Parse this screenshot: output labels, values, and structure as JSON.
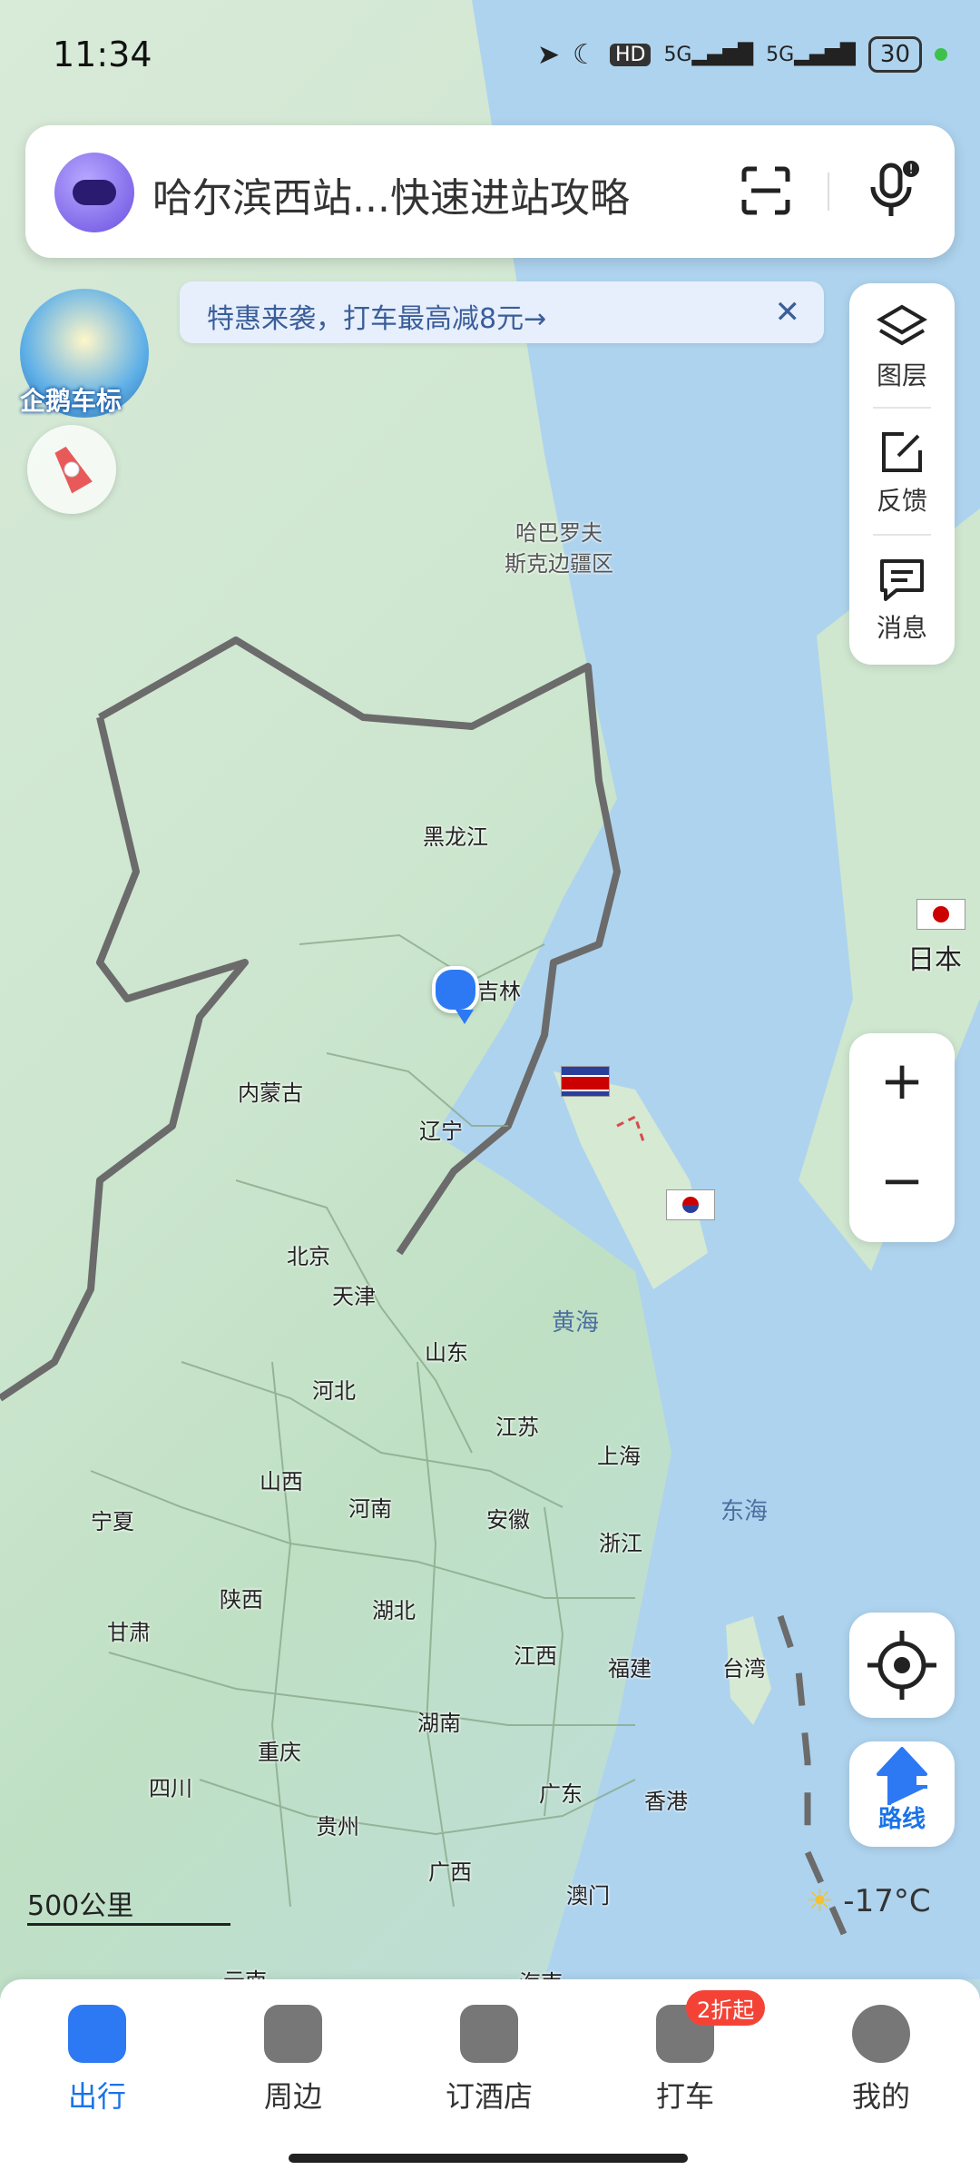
{
  "status_bar": {
    "time": "11:34",
    "signal_label": "5G",
    "battery": "30"
  },
  "search": {
    "query": "哈尔滨西站...快速进站攻略"
  },
  "promo": {
    "text": "特惠来袭，打车最高减8元→",
    "close": "✕"
  },
  "left_controls": {
    "penguin_label": "企鹅车标"
  },
  "right_panel": {
    "items": [
      {
        "label": "图层",
        "icon": "layers-icon"
      },
      {
        "label": "反馈",
        "icon": "feedback-icon"
      },
      {
        "label": "消息",
        "icon": "message-icon"
      }
    ]
  },
  "zoom": {
    "plus": "+",
    "minus": "−"
  },
  "route": {
    "label": "路线"
  },
  "weather": {
    "text": "-17°C"
  },
  "scale": {
    "text": "500公里"
  },
  "map_labels": {
    "khabarovsk": "哈巴罗夫\n斯克边疆区",
    "heilongjiang": "黑龙江",
    "jilin": "吉林",
    "neimenggu": "内蒙古",
    "liaoning": "辽宁",
    "beijing": "北京",
    "tianjin": "天津",
    "shandong": "山东",
    "hebei": "河北",
    "jiangsu": "江苏",
    "shanghai": "上海",
    "shanxi": "山西",
    "henan": "河南",
    "anhui": "安徽",
    "zhejiang": "浙江",
    "ningxia": "宁夏",
    "shaanxi": "陕西",
    "hubei": "湖北",
    "gansu": "甘肃",
    "jiangxi": "江西",
    "fujian": "福建",
    "taiwan": "台湾",
    "hunan": "湖南",
    "chongqing": "重庆",
    "sichuan": "四川",
    "guangdong": "广东",
    "hongkong": "香港",
    "guizhou": "贵州",
    "guangxi": "广西",
    "macau": "澳门",
    "yunnan": "云南",
    "hainan": "海南",
    "japan": "日本",
    "yellow_sea": "黄海",
    "east_sea": "东海"
  },
  "bottom_nav": {
    "tabs": [
      {
        "label": "出行",
        "icon": "travel-icon",
        "active": true
      },
      {
        "label": "周边",
        "icon": "nearby-icon",
        "active": false
      },
      {
        "label": "订酒店",
        "icon": "hotel-icon",
        "active": false
      },
      {
        "label": "打车",
        "icon": "taxi-icon",
        "active": false
      },
      {
        "label": "我的",
        "icon": "profile-icon",
        "active": false
      }
    ],
    "badge": "2折起"
  },
  "colors": {
    "accent": "#2d79f3",
    "land": "#cde6cf",
    "sea": "#bcdcea",
    "border": "#6b6b6b"
  }
}
